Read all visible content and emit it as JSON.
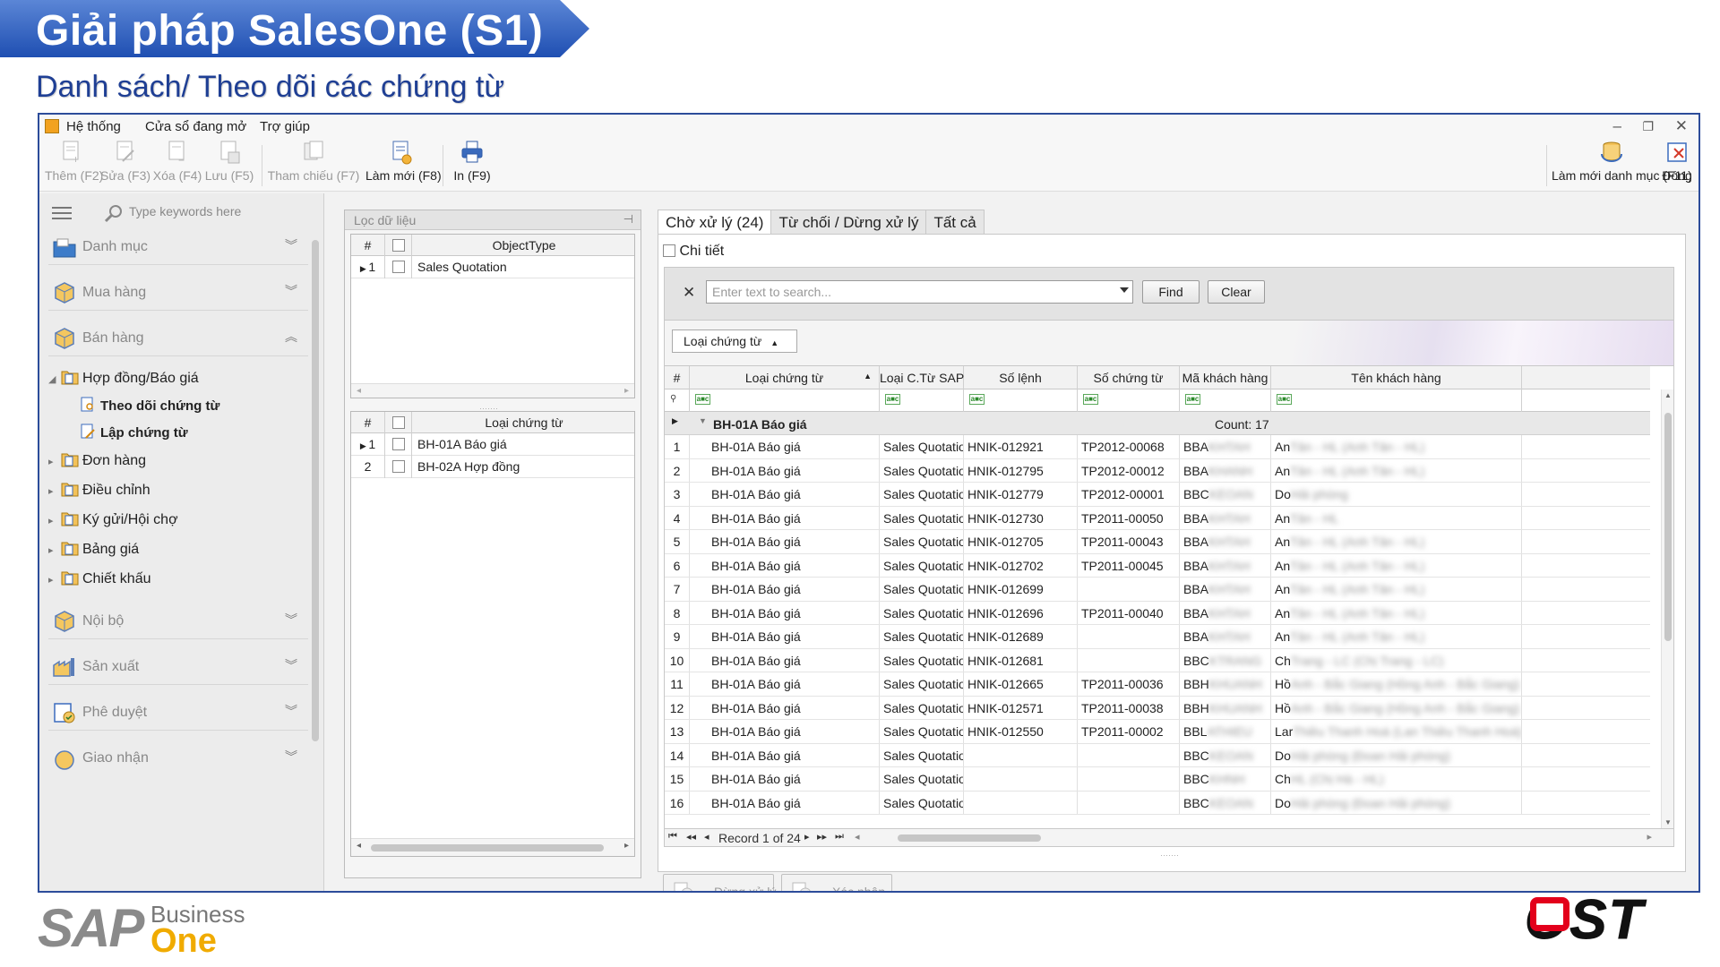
{
  "slide": {
    "title": "Giải pháp SalesOne (S1)",
    "subtitle": "Danh sách/ Theo dõi các chứng từ"
  },
  "menubar": {
    "items": [
      "Hệ thống",
      "Cửa sổ đang mở",
      "Trợ giúp"
    ]
  },
  "toolbar": {
    "add": "Thêm (F2)",
    "edit": "Sửa (F3)",
    "delete": "Xóa (F4)",
    "save": "Lưu (F5)",
    "reference": "Tham chiếu (F7)",
    "refresh": "Làm mới (F8)",
    "print": "In (F9)",
    "refresh_catalog": "Làm mới danh mục (F11)",
    "close": "Đóng"
  },
  "sidebar": {
    "search_placeholder": "Type keywords here",
    "groups": {
      "catalog": "Danh mục",
      "purchase": "Mua hàng",
      "sales": "Bán hàng",
      "internal": "Nội bộ",
      "production": "Sản xuất",
      "approval": "Phê duyệt",
      "delivery": "Giao nhận"
    },
    "tree": {
      "contract_quote": "Hợp đồng/Báo giá",
      "track_docs": "Theo dõi chứng từ",
      "create_docs": "Lập chứng từ",
      "order": "Đơn hàng",
      "adjust": "Điều chỉnh",
      "consign": "Ký gửi/Hội chợ",
      "price_list": "Bảng giá",
      "discount": "Chiết khấu"
    }
  },
  "filter_panel": {
    "title": "Lọc dữ liệu",
    "grid1": {
      "headers": [
        "#",
        "ObjectType"
      ],
      "rows": [
        {
          "num": "1",
          "value": "Sales Quotation"
        }
      ]
    },
    "grid2": {
      "headers": [
        "#",
        "Loại chứng từ"
      ],
      "rows": [
        {
          "num": "1",
          "value": "BH-01A Báo giá"
        },
        {
          "num": "2",
          "value": "BH-02A Hợp đồng"
        }
      ]
    }
  },
  "main": {
    "tabs": [
      "Chờ xử lý (24)",
      "Từ chối / Dừng xử lý",
      "Tất cả"
    ],
    "detail_label": "Chi tiết",
    "search_placeholder": "Enter text to search...",
    "find": "Find",
    "clear": "Clear",
    "group_by": "Loại chứng từ",
    "columns": [
      "#",
      "Loại chứng từ",
      "Loại C.Từ SAP",
      "Số lệnh",
      "Số chứng từ",
      "Mã khách hàng",
      "Tên khách hàng"
    ],
    "filter_glyph": "a■c",
    "group_row": {
      "label": "BH-01A Báo giá",
      "count": "Count: 17"
    },
    "rows": [
      {
        "n": "1",
        "type": "BH-01A Báo giá",
        "sap": "Sales Quotation",
        "cmd": "HNIK-012921",
        "doc": "TP2012-00068",
        "cust": "BBA",
        "cust_blur": "KHTAH",
        "name": "An",
        "name_blur": "Tân - HL (Anh Tân - HL)"
      },
      {
        "n": "2",
        "type": "BH-01A Báo giá",
        "sap": "Sales Quotation",
        "cmd": "HNIK-012795",
        "doc": "TP2012-00012",
        "cust": "BBA",
        "cust_blur": "KHANH",
        "name": "An",
        "name_blur": "Tân - HL (Anh Tân - HL)"
      },
      {
        "n": "3",
        "type": "BH-01A Báo giá",
        "sap": "Sales Quotation",
        "cmd": "HNIK-012779",
        "doc": "TP2012-00001",
        "cust": "BBC",
        "cust_blur": "KEOAN",
        "name": "Do",
        "name_blur": "Hải phòng"
      },
      {
        "n": "4",
        "type": "BH-01A Báo giá",
        "sap": "Sales Quotation",
        "cmd": "HNIK-012730",
        "doc": "TP2011-00050",
        "cust": "BBA",
        "cust_blur": "KHTAH",
        "name": "An",
        "name_blur": "Tân - HL"
      },
      {
        "n": "5",
        "type": "BH-01A Báo giá",
        "sap": "Sales Quotation",
        "cmd": "HNIK-012705",
        "doc": "TP2011-00043",
        "cust": "BBA",
        "cust_blur": "KHTAH",
        "name": "An",
        "name_blur": "Tân - HL (Anh Tân - HL)"
      },
      {
        "n": "6",
        "type": "BH-01A Báo giá",
        "sap": "Sales Quotation",
        "cmd": "HNIK-012702",
        "doc": "TP2011-00045",
        "cust": "BBA",
        "cust_blur": "KHTAH",
        "name": "An",
        "name_blur": "Tân - HL (Anh Tân - HL)"
      },
      {
        "n": "7",
        "type": "BH-01A Báo giá",
        "sap": "Sales Quotation",
        "cmd": "HNIK-012699",
        "doc": "",
        "cust": "BBA",
        "cust_blur": "KHTAH",
        "name": "An",
        "name_blur": "Tân - HL (Anh Tân - HL)"
      },
      {
        "n": "8",
        "type": "BH-01A Báo giá",
        "sap": "Sales Quotation",
        "cmd": "HNIK-012696",
        "doc": "TP2011-00040",
        "cust": "BBA",
        "cust_blur": "KHTAH",
        "name": "An",
        "name_blur": "Tân - HL (Anh Tân - HL)"
      },
      {
        "n": "9",
        "type": "BH-01A Báo giá",
        "sap": "Sales Quotation",
        "cmd": "HNIK-012689",
        "doc": "",
        "cust": "BBA",
        "cust_blur": "KHTAH",
        "name": "An",
        "name_blur": "Tân - HL (Anh Tân - HL)"
      },
      {
        "n": "10",
        "type": "BH-01A Báo giá",
        "sap": "Sales Quotation",
        "cmd": "HNIK-012681",
        "doc": "",
        "cust": "BBC",
        "cust_blur": "KTRANG",
        "name": "Ch",
        "name_blur": "Trang - LC (Chị Trang - LC)"
      },
      {
        "n": "11",
        "type": "BH-01A Báo giá",
        "sap": "Sales Quotation",
        "cmd": "HNIK-012665",
        "doc": "TP2011-00036",
        "cust": "BBH",
        "cust_blur": "KHUANH",
        "name": "Hồ",
        "name_blur": "Anh - Bắc Giang (Hồng Anh - Bắc Giang)"
      },
      {
        "n": "12",
        "type": "BH-01A Báo giá",
        "sap": "Sales Quotation",
        "cmd": "HNIK-012571",
        "doc": "TP2011-00038",
        "cust": "BBH",
        "cust_blur": "KHUANH",
        "name": "Hồ",
        "name_blur": "Anh - Bắc Giang (Hồng Anh - Bắc Giang)"
      },
      {
        "n": "13",
        "type": "BH-01A Báo giá",
        "sap": "Sales Quotation",
        "cmd": "HNIK-012550",
        "doc": "TP2011-00002",
        "cust": "BBL",
        "cust_blur": "ATHIEU",
        "name": "Lar",
        "name_blur": "Thiều Thanh Hoá (Lan Thiều Thanh Hoá)"
      },
      {
        "n": "14",
        "type": "BH-01A Báo giá",
        "sap": "Sales Quotation",
        "cmd": "",
        "doc": "",
        "cust": "BBC",
        "cust_blur": "KEOAN",
        "name": "Do",
        "name_blur": "Hải phòng (Đoan Hải phòng)"
      },
      {
        "n": "15",
        "type": "BH-01A Báo giá",
        "sap": "Sales Quotation",
        "cmd": "",
        "doc": "",
        "cust": "BBC",
        "cust_blur": "KHNH",
        "name": "Ch",
        "name_blur": "HL (Chị Hà - HL)"
      },
      {
        "n": "16",
        "type": "BH-01A Báo giá",
        "sap": "Sales Quotation",
        "cmd": "",
        "doc": "",
        "cust": "BBC",
        "cust_blur": "KEOAN",
        "name": "Do",
        "name_blur": "Hải phòng (Đoan Hải phòng)"
      }
    ],
    "nav": {
      "record": "Record 1 of 24"
    },
    "stop_btn": "Dừng xử lý",
    "confirm_btn": "Xác nhận"
  },
  "footer": {
    "sap_main": "SAP",
    "sap_business": "Business",
    "sap_one": "One",
    "ost": "OST"
  },
  "colors": {
    "title_blue": "#1f4fb2",
    "subtitle_blue": "#1f3f94",
    "sap_blue": "#1a6fb5",
    "sap_gold": "#f0ab00",
    "ost_red": "#e3001b"
  }
}
